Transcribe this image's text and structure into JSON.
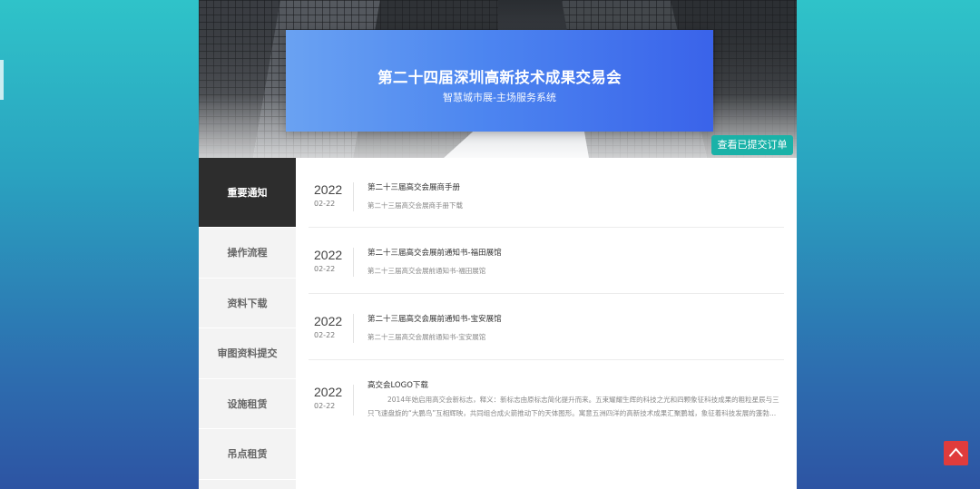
{
  "banner": {
    "title": "第二十四届深圳高新技术成果交易会",
    "subtitle": "智慧城市展-主场服务系统",
    "orders_button": "查看已提交订单"
  },
  "sidebar": {
    "items": [
      {
        "label": "重要通知"
      },
      {
        "label": "操作流程"
      },
      {
        "label": "资料下载"
      },
      {
        "label": "审图资料提交"
      },
      {
        "label": "设施租赁"
      },
      {
        "label": "吊点租赁"
      }
    ]
  },
  "notices": [
    {
      "year": "2022",
      "md": "02-22",
      "title": "第二十三届高交会展商手册",
      "desc": "第二十三届高交会展商手册下载"
    },
    {
      "year": "2022",
      "md": "02-22",
      "title": "第二十三届高交会展前通知书-福田展馆",
      "desc": "第二十三届高交会展前通知书-福田展馆"
    },
    {
      "year": "2022",
      "md": "02-22",
      "title": "第二十三届高交会展前通知书-宝安展馆",
      "desc": "第二十三届高交会展前通知书-宝安展馆"
    },
    {
      "year": "2022",
      "md": "02-22",
      "title": "高交会LOGO下载",
      "desc": "2014年始启用高交会新标志，释义：新标志由原标志简化提升而来。五束耀耀生辉的科技之光和四颗象征科技成果的粗粒星辰与三只飞速盘旋的“大鹏鸟”互相辉映，共同组合成火箭推动下的天体图形。寓意五洲四洋的高新技术成果汇聚鹏城，象征着科技发展的蓬勃生机。"
    }
  ],
  "icons": {
    "back_to_top": "chevron-up-icon"
  },
  "colors": {
    "accent_teal": "#1ab2a8",
    "hero_blue": "#4d86f0",
    "active_nav": "#2d2d2d",
    "back_to_top": "#e03c3c"
  }
}
